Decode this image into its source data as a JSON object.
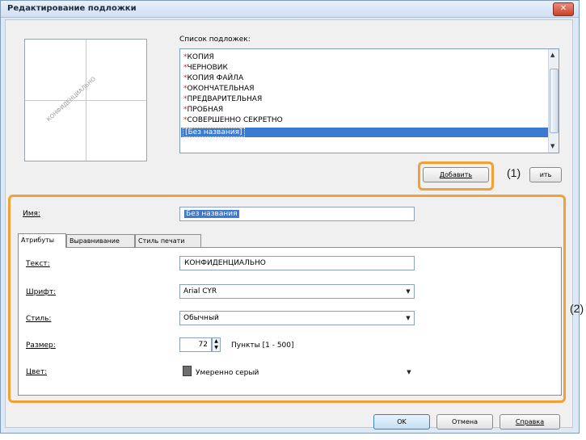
{
  "window": {
    "title": "Редактирование подложки",
    "close_icon": "close-icon"
  },
  "list_label": "Список подложек:",
  "watermark_list": [
    {
      "label": "КОПИЯ",
      "marked": true
    },
    {
      "label": "ЧЕРНОВИК",
      "marked": true
    },
    {
      "label": "КОПИЯ ФАЙЛА",
      "marked": true
    },
    {
      "label": "ОКОНЧАТЕЛЬНАЯ",
      "marked": true
    },
    {
      "label": "ПРЕДВАРИТЕЛЬНАЯ",
      "marked": true
    },
    {
      "label": "ПРОБНАЯ",
      "marked": true
    },
    {
      "label": "СОВЕРШЕННО СЕКРЕТНО",
      "marked": true
    }
  ],
  "selected_item": "[Без названия]",
  "preview_text": "КОНФИДЕНЦИАЛЬНО",
  "buttons": {
    "add": "Добавить",
    "delete_partial": "ить",
    "ok": "OK",
    "cancel": "Отмена",
    "help": "Справка"
  },
  "callouts": {
    "one": "(1)",
    "two": "(2)"
  },
  "name": {
    "label": "Имя:",
    "value": "Без названия"
  },
  "tabs": [
    "Атрибуты",
    "Выравнивание",
    "Стиль печати"
  ],
  "attributes": {
    "text_label": "Текст:",
    "text_value": "КОНФИДЕНЦИАЛЬНО",
    "font_label": "Шрифт:",
    "font_value": "Arial CYR",
    "style_label": "Стиль:",
    "style_value": "Обычный",
    "size_label": "Размер:",
    "size_value": "72",
    "size_unit": "Пункты [1 - 500]",
    "color_label": "Цвет:",
    "color_value": "Умеренно серый",
    "color_swatch": "#6e6e6e"
  },
  "colors": {
    "accent": "#f2a035",
    "selection": "#3b7ad0"
  }
}
